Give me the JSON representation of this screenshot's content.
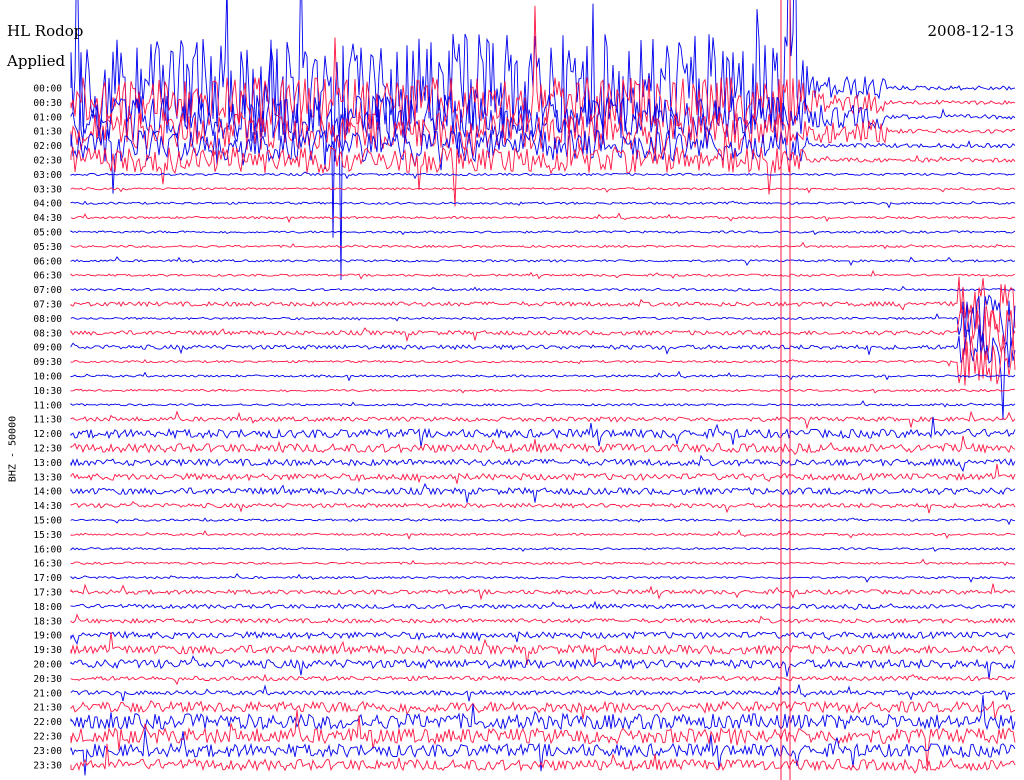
{
  "header": {
    "station": "HL Rodop",
    "filter": "Applied",
    "date": "2008-12-13",
    "channel_label": "BHZ - 50000"
  },
  "colors": {
    "even_rows": "#0000ee",
    "odd_rows": "#ff1744",
    "background": "#ffffff"
  },
  "chart_data": {
    "type": "line",
    "title": "HL Rodop 2008-12-13",
    "ylabel": "BHZ - 50000",
    "row_labels": [
      "00:00",
      "00:30",
      "01:00",
      "01:30",
      "02:00",
      "02:30",
      "03:00",
      "03:30",
      "04:00",
      "04:30",
      "05:00",
      "05:30",
      "06:00",
      "06:30",
      "07:00",
      "07:30",
      "08:00",
      "08:30",
      "09:00",
      "09:30",
      "10:00",
      "10:30",
      "11:00",
      "11:30",
      "12:00",
      "12:30",
      "13:00",
      "13:30",
      "14:00",
      "14:30",
      "15:00",
      "15:30",
      "16:00",
      "16:30",
      "17:00",
      "17:30",
      "18:00",
      "18:30",
      "19:00",
      "19:30",
      "20:00",
      "20:30",
      "21:00",
      "21:30",
      "22:00",
      "22:30",
      "23:00",
      "23:30"
    ],
    "row_noise_level": [
      2,
      2,
      2,
      2,
      2,
      2,
      1,
      1,
      1,
      1,
      1,
      1,
      1,
      1,
      1,
      2,
      1,
      2,
      2,
      1,
      1,
      1,
      1,
      2,
      4,
      4,
      3,
      3,
      3,
      2,
      1,
      1,
      1,
      1,
      1,
      2,
      2,
      2,
      3,
      4,
      4,
      2,
      2,
      5,
      7,
      7,
      6,
      5
    ],
    "colors_alternate": [
      "#0000ee",
      "#ff1744"
    ],
    "annotations": [
      "large-amplitude saturation 00:00–02:30",
      "event near 08:30–09:30 at right edge",
      "spike near 11:30"
    ]
  }
}
